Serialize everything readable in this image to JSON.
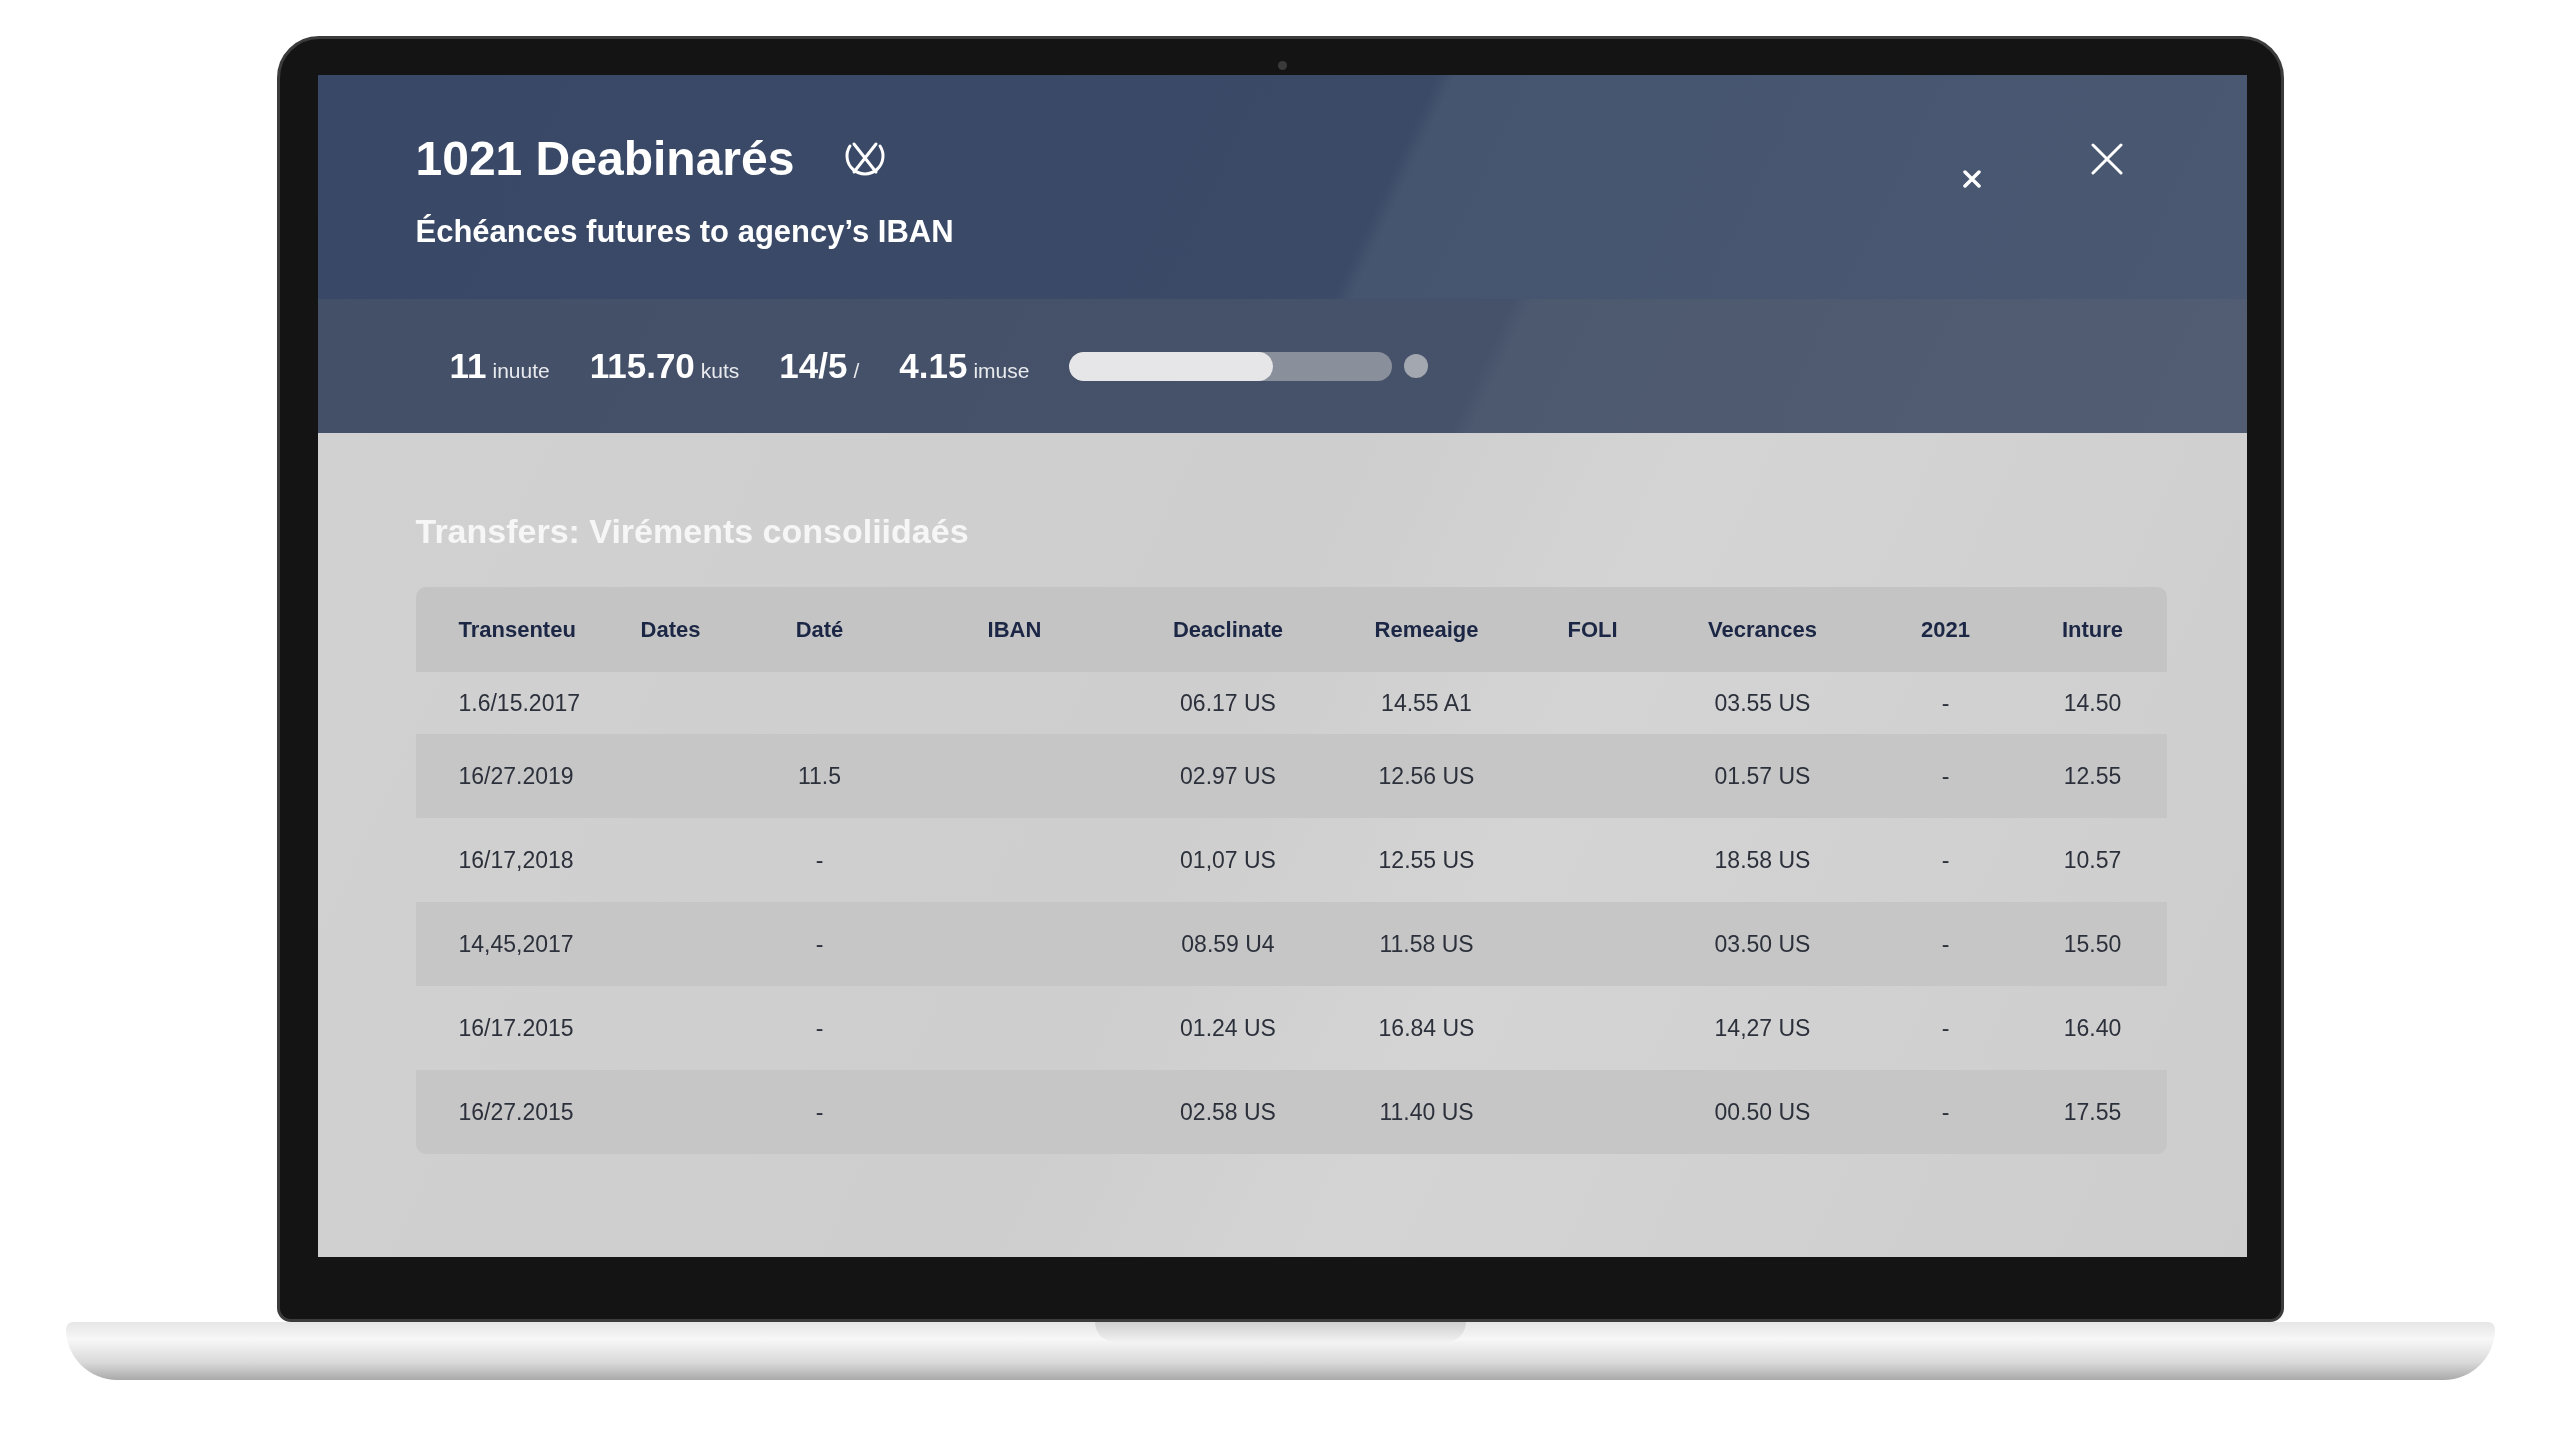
{
  "window": {
    "title": "1021 Deabinarés",
    "subtitle": "Échéances futures to agency’s IBAN"
  },
  "stats": [
    {
      "value": "11",
      "unit": "inuute"
    },
    {
      "value": "115.70",
      "unit": "kuts"
    },
    {
      "value": "14/5",
      "unit": "/"
    },
    {
      "value": "4.15",
      "unit": "imuse"
    }
  ],
  "progress": {
    "level": 0.63
  },
  "section": {
    "title": "Transfers: Viréments consoliidaés"
  },
  "table": {
    "columns": [
      "Transenteu",
      "Dates",
      "Daté",
      "IBAN",
      "Deaclinate",
      "Remeaige",
      "FOLI",
      "Vecrances",
      "2021",
      "Inture"
    ],
    "rows": [
      {
        "cells": [
          "1.6/15.2017",
          null,
          null,
          null,
          "06.17 US",
          "14.55 A1",
          null,
          "03.55 US",
          "-",
          "14.50"
        ]
      },
      {
        "cells": [
          "16/27.2019",
          null,
          "11.5",
          null,
          "02.97 US",
          "12.56 US",
          null,
          "01.57 US",
          "-",
          "12.55"
        ]
      },
      {
        "cells": [
          "16/17,2018",
          null,
          "-",
          null,
          "01,07 US",
          "12.55 US",
          null,
          "18.58 US",
          "-",
          "10.57"
        ]
      },
      {
        "cells": [
          "14,45,2017",
          null,
          "-",
          null,
          "08.59 U4",
          "11.58 US",
          null,
          "03.50 US",
          "-",
          "15.50"
        ]
      },
      {
        "cells": [
          "16/17.2015",
          null,
          "-",
          null,
          "01.24 US",
          "16.84 US",
          null,
          "14,27 US",
          "-",
          "16.40"
        ]
      },
      {
        "cells": [
          "16/27.2015",
          null,
          "-",
          null,
          "02.58 US",
          "11.40 US",
          null,
          "00.50 US",
          "-",
          "17.55"
        ]
      }
    ]
  }
}
